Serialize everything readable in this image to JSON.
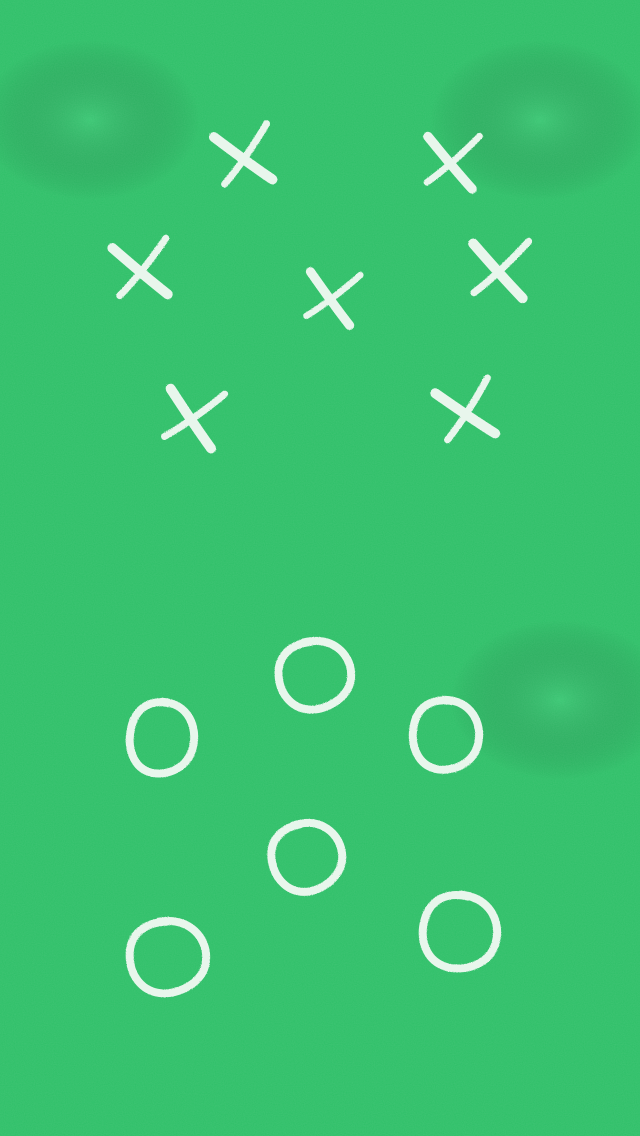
{
  "background": {
    "color": "#2DBF67",
    "highlight_color": "#4FD588",
    "mark_color": "#E8F6EC"
  },
  "marks": [
    {
      "name": "x-mark",
      "icon": "x-icon"
    },
    {
      "name": "o-mark",
      "icon": "o-icon"
    }
  ]
}
